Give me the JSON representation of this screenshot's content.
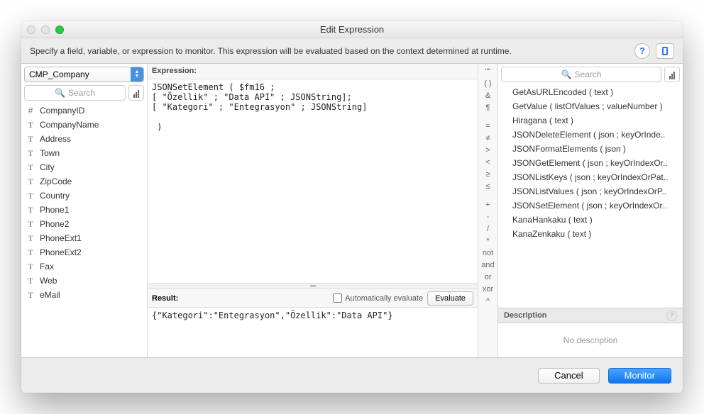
{
  "window": {
    "title": "Edit Expression"
  },
  "subtitle": "Specify a field, variable, or expression to monitor. This expression will be evaluated based on the context determined at runtime.",
  "left": {
    "table": "CMP_Company",
    "search_placeholder": "Search",
    "fields": [
      {
        "icon": "#",
        "name": "CompanyID"
      },
      {
        "icon": "T",
        "name": "CompanyName"
      },
      {
        "icon": "T",
        "name": "Address"
      },
      {
        "icon": "T",
        "name": "Town"
      },
      {
        "icon": "T",
        "name": "City"
      },
      {
        "icon": "T",
        "name": "ZipCode"
      },
      {
        "icon": "T",
        "name": "Country"
      },
      {
        "icon": "T",
        "name": "Phone1"
      },
      {
        "icon": "T",
        "name": "Phone2"
      },
      {
        "icon": "T",
        "name": "PhoneExt1"
      },
      {
        "icon": "T",
        "name": "PhoneExt2"
      },
      {
        "icon": "T",
        "name": "Fax"
      },
      {
        "icon": "T",
        "name": "Web"
      },
      {
        "icon": "T",
        "name": "eMail"
      }
    ]
  },
  "center": {
    "expr_label": "Expression:",
    "expression": "JSONSetElement ( $fm16 ;\n[ \"Özellik\" ; \"Data API\" ; JSONString];\n[ \"Kategori\" ; \"Entegrasyon\" ; JSONString]\n\n )",
    "result_label": "Result:",
    "auto_label": "Automatically evaluate",
    "eval_label": "Evaluate",
    "result": "{\"Kategori\":\"Entegrasyon\",\"Özellik\":\"Data API\"}"
  },
  "ops": [
    "\"\"",
    "( )",
    "&",
    "¶",
    "",
    "=",
    "≠",
    ">",
    "<",
    "≥",
    "≤",
    "",
    "+",
    "-",
    "/",
    "*",
    "not",
    "and",
    "or",
    "xor",
    "^"
  ],
  "right": {
    "search_placeholder": "Search",
    "functions": [
      "GetAsURLEncoded ( text )",
      "GetValue ( listOfValues ; valueNumber )",
      "Hiragana ( text )",
      "JSONDeleteElement ( json ; keyOrInde..",
      "JSONFormatElements ( json )",
      "JSONGetElement ( json ; keyOrIndexOr..",
      "JSONListKeys ( json ; keyOrIndexOrPat..",
      "JSONListValues ( json ; keyOrIndexOrP..",
      "JSONSetElement ( json ; keyOrIndexOr..",
      "KanaHankaku ( text )",
      "KanaZenkaku ( text )"
    ],
    "desc_label": "Description",
    "desc_body": "No description"
  },
  "footer": {
    "cancel": "Cancel",
    "monitor": "Monitor"
  }
}
